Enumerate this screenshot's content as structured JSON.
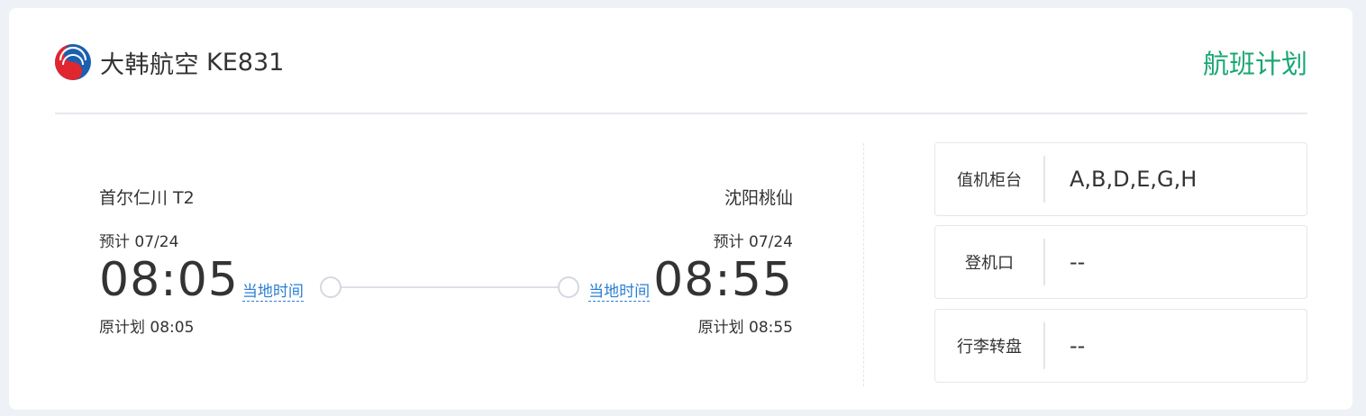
{
  "flight": {
    "airline_name": "大韩航空",
    "flight_number": "KE831",
    "plan_link": "航班计划",
    "logo_icon": "korean-air-taegeuk-logo"
  },
  "departure": {
    "airport": "首尔仁川 T2",
    "scheduled_label": "预计 07/24",
    "time": "08:05",
    "local_time_label": "当地时间",
    "original_plan": "原计划 08:05"
  },
  "arrival": {
    "airport": "沈阳桃仙",
    "scheduled_label": "预计 07/24",
    "time": "08:55",
    "local_time_label": "当地时间",
    "original_plan": "原计划 08:55"
  },
  "info": {
    "checkin": {
      "label": "值机柜台",
      "value": "A,B,D,E,G,H"
    },
    "gate": {
      "label": "登机口",
      "value": "--"
    },
    "baggage": {
      "label": "行李转盘",
      "value": "--"
    }
  },
  "colors": {
    "accent_green": "#1aa773",
    "link_blue": "#2a7fd4",
    "background": "#eef1f6"
  }
}
